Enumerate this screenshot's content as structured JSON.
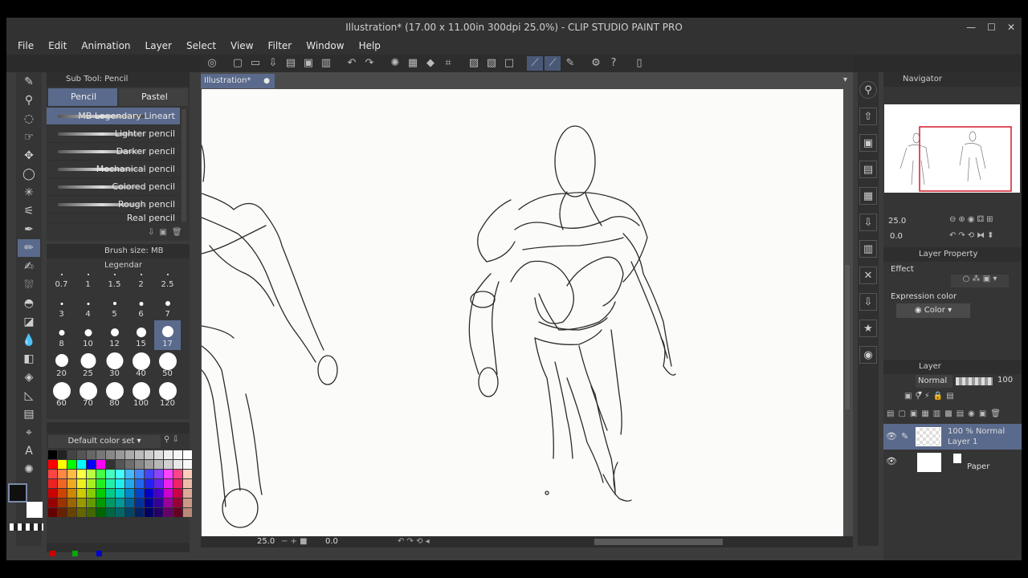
{
  "window": {
    "title": "Illustration* (17.00 x 11.00in 300dpi 25.0%) - CLIP STUDIO PAINT PRO",
    "controls": [
      "—",
      "☐",
      "✕"
    ]
  },
  "menu": [
    "File",
    "Edit",
    "Animation",
    "Layer",
    "Select",
    "View",
    "Filter",
    "Window",
    "Help"
  ],
  "subtool": {
    "header": "Sub Tool: Pencil",
    "tabs": [
      "Pencil",
      "Pastel"
    ],
    "brushes": [
      "MB Legendary Lineart",
      "Lighter pencil",
      "Darker pencil",
      "Mechanical pencil",
      "Colored pencil",
      "Rough pencil",
      "Real pencil"
    ]
  },
  "brushsize": {
    "header": "Brush size: MB Legendar",
    "sizes": [
      "0.7",
      "1",
      "1.5",
      "2",
      "2.5",
      "3",
      "4",
      "5",
      "6",
      "7",
      "8",
      "10",
      "12",
      "15",
      "17",
      "20",
      "25",
      "30",
      "40",
      "50",
      "60",
      "70",
      "80",
      "100",
      "120"
    ],
    "selected": "17"
  },
  "colorset": {
    "name": "Default color set"
  },
  "document": {
    "tab": "Illustration*",
    "zoom": "25.0",
    "angle": "0.0"
  },
  "navigator": {
    "title": "Navigator",
    "zoom": "25.0",
    "angle": "0.0"
  },
  "layer_property": {
    "title": "Layer Property",
    "effect": "Effect",
    "expression_color_label": "Expression color",
    "expression_color_value": "Color"
  },
  "layer_panel": {
    "title": "Layer",
    "blend": "Normal",
    "opacity": "100",
    "layers": [
      {
        "line1": "100 % Normal",
        "line2": "Layer 1"
      },
      {
        "line1": "",
        "line2": "Paper"
      }
    ]
  },
  "colors": {
    "accent": "#5a6a8c",
    "panel": "#353535",
    "nav_frame": "#d41a2a"
  }
}
